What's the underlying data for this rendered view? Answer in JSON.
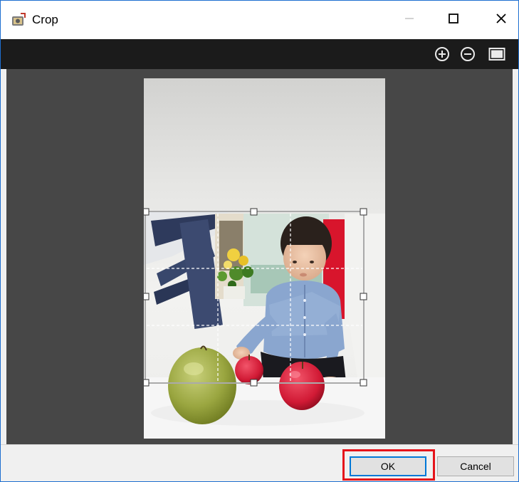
{
  "window": {
    "title": "Crop",
    "icon": "crop-app-icon",
    "controls": [
      "minimize-icon",
      "maximize-icon",
      "close-icon"
    ]
  },
  "toolbar": {
    "tools": [
      "zoom-in-icon",
      "zoom-out-icon",
      "fit-to-window-icon"
    ]
  },
  "image": {
    "subject": "crop-photo"
  },
  "buttons": {
    "ok_label": "OK",
    "cancel_label": "Cancel"
  },
  "colors": {
    "titlebar": "#ffffff",
    "toolbar": "#1b1b1b",
    "workspace": "#474747",
    "highlight": "#e5141b",
    "focus": "#0078d7"
  }
}
